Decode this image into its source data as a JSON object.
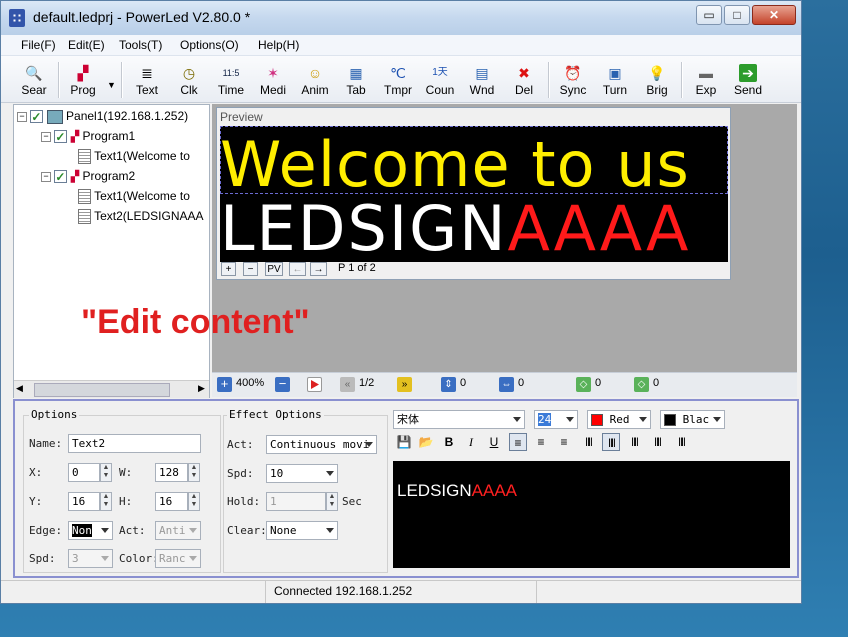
{
  "window": {
    "title": "default.ledprj - PowerLed V2.80.0 *",
    "minimize": "▭",
    "maximize": "□",
    "close": "✕"
  },
  "menu": [
    "File(F)",
    "Edit(E)",
    "Tools(T)",
    "Options(O)",
    "Help(H)"
  ],
  "toolbar": [
    {
      "label": "Sear",
      "icon": "🔍"
    },
    {
      "label": "Prog",
      "icon": "▞"
    },
    {
      "label": "Text",
      "icon": "≣"
    },
    {
      "label": "Clk",
      "icon": "◷"
    },
    {
      "label": "Time",
      "icon": "11:5"
    },
    {
      "label": "Medi",
      "icon": "✶"
    },
    {
      "label": "Anim",
      "icon": "☺"
    },
    {
      "label": "Tab",
      "icon": "▦"
    },
    {
      "label": "Tmpr",
      "icon": "℃"
    },
    {
      "label": "Coun",
      "icon": "1天"
    },
    {
      "label": "Wnd",
      "icon": "▤"
    },
    {
      "label": "Del",
      "icon": "✖"
    },
    {
      "label": "Sync",
      "icon": "⏰"
    },
    {
      "label": "Turn",
      "icon": "▣"
    },
    {
      "label": "Brig",
      "icon": "💡"
    },
    {
      "label": "Exp",
      "icon": "▬"
    },
    {
      "label": "Send",
      "icon": "➔"
    }
  ],
  "tree": [
    {
      "label": "Panel1(192.168.1.252)",
      "level": 0
    },
    {
      "label": "Program1",
      "level": 1
    },
    {
      "label": "Text1(Welcome to",
      "level": 2
    },
    {
      "label": "Program2",
      "level": 1
    },
    {
      "label": "Text1(Welcome to",
      "level": 2
    },
    {
      "label": "Text2(LEDSIGNAAA",
      "level": 2
    }
  ],
  "preview": {
    "title": "Preview",
    "line1": "Welcome to us",
    "line2_white": "LEDSIGN",
    "line2_red": "AAAA",
    "page_label": "P 1 of 2",
    "buttons": {
      "plus": "+",
      "minus": "−",
      "pv": "PV",
      "prev": "←",
      "next": "→"
    }
  },
  "overlay_text": "\"Edit content\"",
  "navbar": {
    "zoom": "400%",
    "page": "1/2",
    "v1": "0",
    "v2": "0",
    "v3": "0",
    "v4": "0"
  },
  "options": {
    "title": "Options",
    "name_label": "Name:",
    "name": "Text2",
    "x_label": "X:",
    "x": "0",
    "w_label": "W:",
    "w": "128",
    "y_label": "Y:",
    "y": "16",
    "h_label": "H:",
    "h": "16",
    "edge_label": "Edge:",
    "edge": "Non",
    "act_label": "Act:",
    "act": "Anti",
    "spd_label": "Spd:",
    "spd": "3",
    "color_label": "Color:",
    "color": "Ranc"
  },
  "effect": {
    "title": "Effect Options",
    "act_label": "Act:",
    "act": "Continuous movi",
    "spd_label": "Spd:",
    "spd": "10",
    "hold_label": "Hold:",
    "hold": "1",
    "hold_unit": "Sec",
    "clear_label": "Clear:",
    "clear": "None"
  },
  "format": {
    "font": "宋体",
    "size": "24",
    "fg_color": "Red",
    "bg_color": "Blac",
    "fg_hex": "#ff0000",
    "bg_hex": "#000000"
  },
  "editor": {
    "white": "LEDSIGN",
    "red": "AAAA"
  },
  "status": {
    "text": "Connected 192.168.1.252"
  }
}
